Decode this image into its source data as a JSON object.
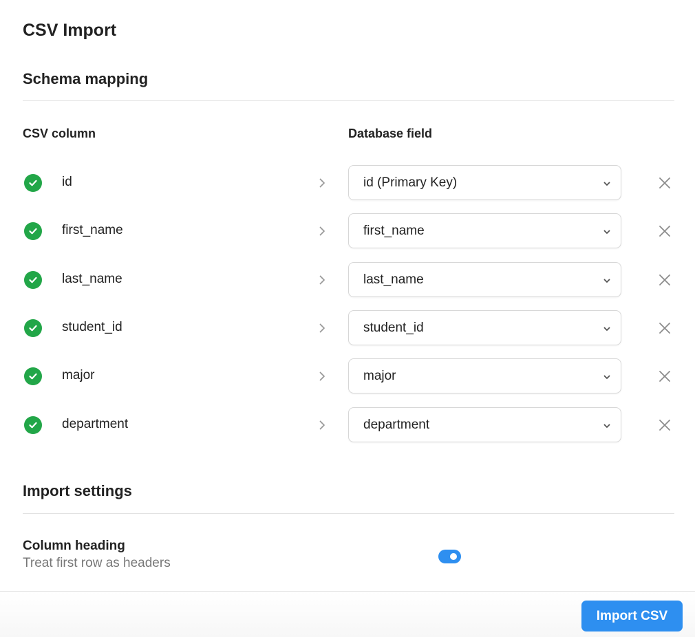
{
  "header": {
    "title": "CSV Import"
  },
  "schema": {
    "title": "Schema mapping",
    "csv_column_header": "CSV column",
    "db_field_header": "Database field",
    "rows": [
      {
        "csv": "id",
        "field": "id (Primary Key)"
      },
      {
        "csv": "first_name",
        "field": "first_name"
      },
      {
        "csv": "last_name",
        "field": "last_name"
      },
      {
        "csv": "student_id",
        "field": "student_id"
      },
      {
        "csv": "major",
        "field": "major"
      },
      {
        "csv": "department",
        "field": "department"
      }
    ]
  },
  "settings": {
    "title": "Import settings",
    "column_heading": {
      "title": "Column heading",
      "description": "Treat first row as headers",
      "enabled": true
    }
  },
  "footer": {
    "import_label": "Import CSV"
  },
  "colors": {
    "success": "#22a648",
    "accent": "#2e8ff0"
  },
  "icons": {
    "status": "check-circle-icon",
    "arrow": "chevron-right-icon",
    "dropdown": "chevron-down-icon",
    "remove": "close-icon"
  }
}
